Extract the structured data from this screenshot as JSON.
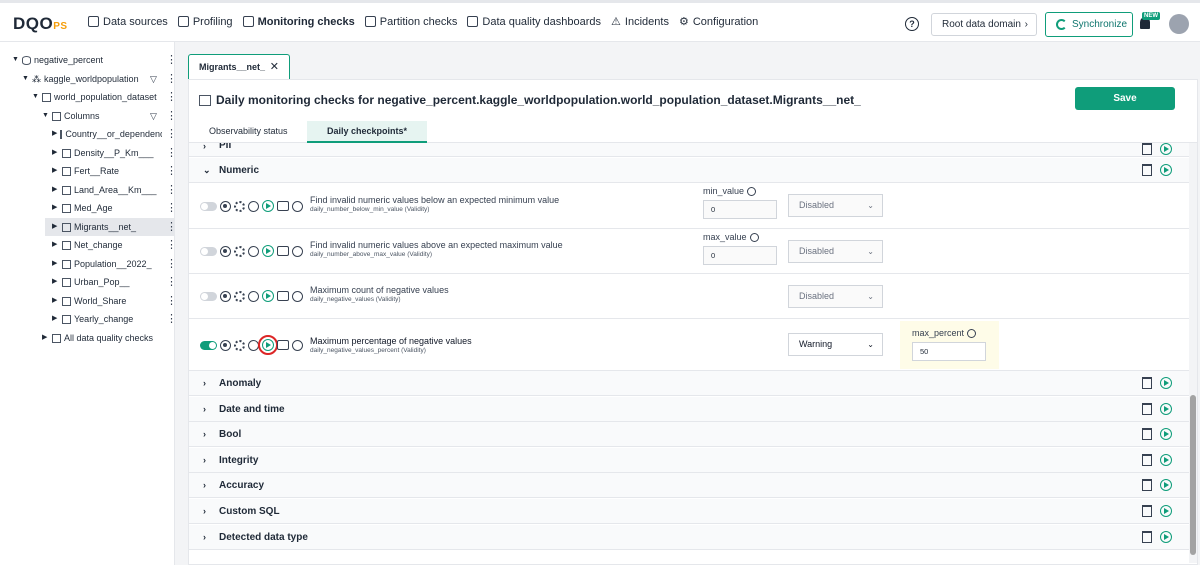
{
  "app": {
    "logo_main": "DQO",
    "logo_sub": "PS"
  },
  "nav": [
    "Data sources",
    "Profiling",
    "Monitoring checks",
    "Partition checks",
    "Data quality dashboards",
    "Incidents",
    "Configuration"
  ],
  "header": {
    "help": "?",
    "root_domain": "Root data domain",
    "sync": "Synchronize",
    "new_badge": "NEW"
  },
  "tree": [
    {
      "label": "negative_percent"
    },
    {
      "label": "kaggle_worldpopulation"
    },
    {
      "label": "world_population_dataset"
    },
    {
      "label": "Columns"
    },
    {
      "label": "Country__or_dependency"
    },
    {
      "label": "Density__P_Km___"
    },
    {
      "label": "Fert__Rate"
    },
    {
      "label": "Land_Area__Km___"
    },
    {
      "label": "Med_Age"
    },
    {
      "label": "Migrants__net_"
    },
    {
      "label": "Net_change"
    },
    {
      "label": "Population__2022_"
    },
    {
      "label": "Urban_Pop__"
    },
    {
      "label": "World_Share"
    },
    {
      "label": "Yearly_change"
    },
    {
      "label": "All data quality checks"
    }
  ],
  "tab": {
    "label": "Migrants__net_",
    "close": "✕"
  },
  "page": {
    "title": "Daily monitoring checks for negative_percent.kaggle_worldpopulation.world_population_dataset.Migrants__net_",
    "save": "Save",
    "subtabs": [
      "Observability status",
      "Daily checkpoints*"
    ]
  },
  "sections_top": [
    {
      "label": "PII"
    },
    {
      "label": "Numeric"
    }
  ],
  "checks": [
    {
      "name": "Find invalid numeric values below an expected minimum value",
      "sub": "daily_number_below_min_value (Validity)",
      "param_label": "min_value",
      "param_value": "0",
      "severity": "Disabled"
    },
    {
      "name": "Find invalid numeric values above an expected maximum value",
      "sub": "daily_number_above_max_value (Validity)",
      "param_label": "max_value",
      "param_value": "0",
      "severity": "Disabled"
    },
    {
      "name": "Maximum count of negative values",
      "sub": "daily_negative_values (Validity)",
      "severity": "Disabled"
    },
    {
      "name": "Maximum percentage of negative values",
      "sub": "daily_negative_values_percent (Validity)",
      "severity": "Warning",
      "param_label": "max_percent",
      "param_value": "50"
    }
  ],
  "sections_bottom": [
    {
      "label": "Anomaly"
    },
    {
      "label": "Date and time"
    },
    {
      "label": "Bool"
    },
    {
      "label": "Integrity"
    },
    {
      "label": "Accuracy"
    },
    {
      "label": "Custom SQL"
    },
    {
      "label": "Detected data type"
    }
  ]
}
